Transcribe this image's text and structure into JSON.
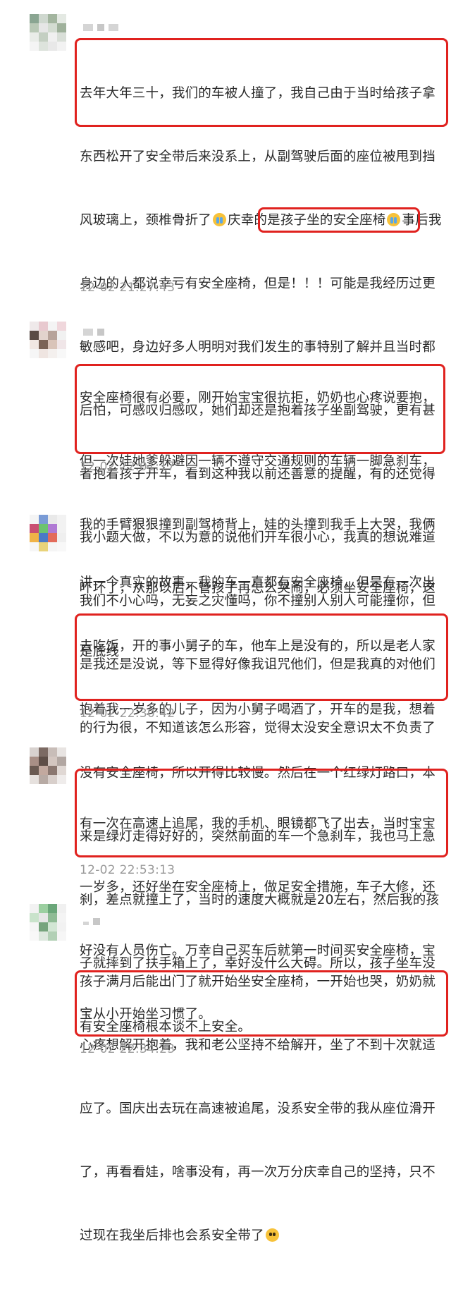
{
  "comments": [
    {
      "lines": [
        "去年大年三十，我们的车被人撞了，我自己由于当时给孩子拿",
        "东西松开了安全带后来没系上，从副驾驶后面的座位被甩到挡",
        "风玻璃上，颈椎骨折了",
        "庆幸的是孩子坐的安全座椅",
        "事后我",
        "身边的人都说幸亏有安全座椅，但是！！！可能是我经历过更",
        "敏感吧，身边好多人明明对我们发生的事特别了解并且当时都",
        "后怕，可感叹归感叹，她们却还是抱着孩子坐副驾驶，更有甚",
        "者抱着孩子开车，看到这种我以前还善意的提醒，有的还觉得",
        "我小题大做，不以为意的说他们开车很小心，我真的想说难道",
        "我们不小心吗，无妄之灾懂吗，",
        "你不撞别人别人可能撞你，",
        "但",
        "是我还是没说，等下显得好像我诅咒他们，但是我真的对他们",
        "的行为很，不知道该怎么形容，觉得太没安全意识太不负责了"
      ],
      "timestamp": "12-02 21:27:43"
    },
    {
      "lines": [
        "安全座椅很有必要，刚开始宝宝很抗拒，奶奶也心疼说要抱，",
        "但一次娃她爹躲避因一辆不遵守交通规则的车辆一脚急刹车，",
        "我的手臂狠狠撞到副驾椅背上，娃的头撞到我手上大哭，我俩",
        "吓坏了，从那以后不管孩子再怎么哭闹，必须坐安全座椅，这",
        "是底线"
      ],
      "timestamp": "12-02 22:01:17"
    },
    {
      "lines": [
        "讲一个真实的故事，我的车一直都有安全座椅，但是有一次出",
        "去吃饭，开的事小舅子的车，他车上是没有的，所以是老人家",
        "抱着我一岁多的儿子，因为小舅子喝酒了，开车的是我，想着",
        "没有安全座椅，所以开得比较慢。然后在一个红绿灯路口，本",
        "来是绿灯走得好好的，突然前面的车一个急刹车，我也马上急",
        "刹，差点就撞上了，当时的速度大概就是20左右，然后我的孩",
        "子就摔到了扶手箱上了，幸好没什么大碍。所以，孩子坐车没",
        "有安全座椅根本谈不上安全。"
      ],
      "timestamp": "12-02 22:30:42"
    },
    {
      "lines": [
        "有一次在高速上追尾，我的手机、眼镜都飞了出去，当时宝宝",
        "一岁多，还好坐在安全座椅上，做足安全措施，车子大修，还",
        "好没有人员伤亡。万幸自己买车后就第一时间买安全座椅，宝",
        "宝从小开始坐习惯了。"
      ],
      "timestamp": "12-02 22:53:13"
    },
    {
      "lines": [
        "孩子满月后能出门了就开始坐安全座椅，一开始也哭，奶奶就",
        "心疼想解开抱着，我和老公坚持不给解开，坐了不到十次就适",
        "应了。国庆出去玩在高速被追尾，没系安全带的我从座位滑开",
        "了，再看看娃，啥事没有，再一次万分庆幸自己的坚持，只不",
        "过现在我坐后排也会系安全带了"
      ],
      "timestamp": "12-02 22:34:23"
    }
  ],
  "emoji": [
    "crying-face-icon",
    "tears-of-joy-icon"
  ],
  "colors": {
    "highlight": "#e0221f",
    "timestamp": "#9a9a9a",
    "text": "#2a2a2a"
  }
}
